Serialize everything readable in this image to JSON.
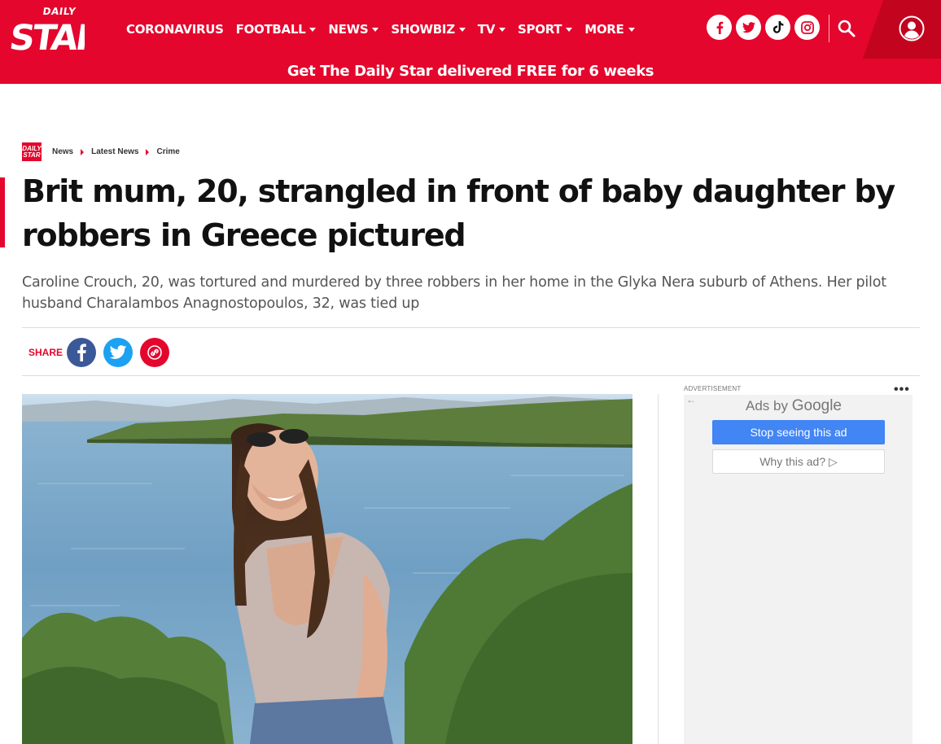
{
  "header": {
    "logo_text_top": "DAILY",
    "logo_text_main": "STAR",
    "nav": [
      {
        "label": "CORONAVIRUS",
        "dropdown": false
      },
      {
        "label": "FOOTBALL",
        "dropdown": true
      },
      {
        "label": "NEWS",
        "dropdown": true
      },
      {
        "label": "SHOWBIZ",
        "dropdown": true
      },
      {
        "label": "TV",
        "dropdown": true
      },
      {
        "label": "SPORT",
        "dropdown": true
      },
      {
        "label": "MORE",
        "dropdown": true
      }
    ],
    "social_icons": [
      "facebook-icon",
      "twitter-icon",
      "tiktok-icon",
      "instagram-icon"
    ],
    "search_icon": "search-icon",
    "account_icon": "user-icon",
    "promo": "Get The Daily Star delivered FREE for 6 weeks",
    "brand_color": "#e4062d"
  },
  "breadcrumb": {
    "logo_text": "DAILY STAR",
    "items": [
      "News",
      "Latest News",
      "Crime"
    ]
  },
  "article": {
    "headline": "Brit mum, 20, strangled in front of baby daughter by robbers in Greece pictured",
    "standfirst": "Caroline Crouch, 20, was tortured and murdered by three robbers in her home in the Glyka Nera suburb of Athens. Her pilot husband Charalambos Anagnostopoulos, 32, was tied up"
  },
  "share": {
    "label": "SHARE",
    "buttons": [
      "facebook-icon",
      "twitter-icon",
      "link-icon"
    ],
    "colors": {
      "facebook": "#3b5998",
      "twitter": "#1da1f2",
      "link": "#e4062d"
    }
  },
  "ad": {
    "label": "ADVERTISEMENT",
    "more": "•••",
    "back": "←",
    "ads_by": "Ads by",
    "google": "Google",
    "stop_label": "Stop seeing this ad",
    "why_label": "Why this ad? ▷",
    "stop_color": "#4285f4"
  }
}
